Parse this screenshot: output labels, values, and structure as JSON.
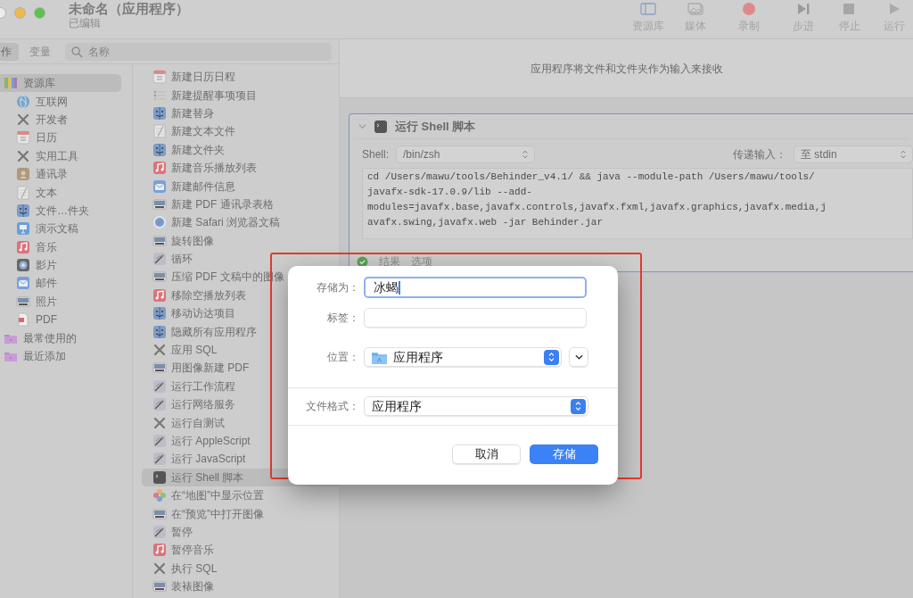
{
  "window": {
    "title": "未命名（应用程序）",
    "subtitle": "已编辑"
  },
  "toolbar": [
    {
      "label": "资源库"
    },
    {
      "label": "媒体"
    },
    {
      "label": "录制"
    },
    {
      "label": "步进"
    },
    {
      "label": "停止"
    },
    {
      "label": "运行"
    }
  ],
  "library_tabs": [
    {
      "label": "作",
      "selected": true
    },
    {
      "label": "变量",
      "selected": false
    }
  ],
  "search": {
    "placeholder": "名称"
  },
  "library": [
    {
      "label": "资源库",
      "selected": true,
      "children": [
        {
          "label": "互联网",
          "selected": false
        },
        {
          "label": "开发者",
          "selected": false
        },
        {
          "label": "日历",
          "selected": false
        },
        {
          "label": "实用工具",
          "selected": false
        },
        {
          "label": "通讯录",
          "selected": false
        },
        {
          "label": "文本",
          "selected": false
        },
        {
          "label": "文件…件夹",
          "selected": false
        },
        {
          "label": "演示文稿",
          "selected": false
        },
        {
          "label": "音乐",
          "selected": false
        },
        {
          "label": "影片",
          "selected": false
        },
        {
          "label": "邮件",
          "selected": false
        },
        {
          "label": "照片",
          "selected": false
        },
        {
          "label": "PDF",
          "selected": false
        }
      ]
    },
    {
      "label": "最常使用的",
      "selected": false
    },
    {
      "label": "最近添加",
      "selected": false
    }
  ],
  "actions": [
    {
      "label": "新建日历日程",
      "selected": false
    },
    {
      "label": "新建提醒事项项目",
      "selected": false
    },
    {
      "label": "新建替身",
      "selected": false
    },
    {
      "label": "新建文本文件",
      "selected": false
    },
    {
      "label": "新建文件夹",
      "selected": false
    },
    {
      "label": "新建音乐播放列表",
      "selected": false
    },
    {
      "label": "新建邮件信息",
      "selected": false
    },
    {
      "label": "新建 PDF 通讯录表格",
      "selected": false
    },
    {
      "label": "新建 Safari 浏览器文稿",
      "selected": false
    },
    {
      "label": "旋转图像",
      "selected": false
    },
    {
      "label": "循环",
      "selected": false
    },
    {
      "label": "压缩 PDF 文稿中的图像",
      "selected": false
    },
    {
      "label": "移除空播放列表",
      "selected": false
    },
    {
      "label": "移动访达项目",
      "selected": false
    },
    {
      "label": "隐藏所有应用程序",
      "selected": false
    },
    {
      "label": "应用 SQL",
      "selected": false
    },
    {
      "label": "用图像新建 PDF",
      "selected": false
    },
    {
      "label": "运行工作流程",
      "selected": false
    },
    {
      "label": "运行网络服务",
      "selected": false
    },
    {
      "label": "运行自测试",
      "selected": false
    },
    {
      "label": "运行 AppleScript",
      "selected": false
    },
    {
      "label": "运行 JavaScript",
      "selected": false
    },
    {
      "label": "运行 Shell 脚本",
      "selected": true
    },
    {
      "label": "在“地图”中显示位置",
      "selected": false
    },
    {
      "label": "在“预览”中打开图像",
      "selected": false
    },
    {
      "label": "暂停",
      "selected": false
    },
    {
      "label": "暂停音乐",
      "selected": false
    },
    {
      "label": "执行 SQL",
      "selected": false
    },
    {
      "label": "装裱图像",
      "selected": false
    }
  ],
  "workflow": {
    "input_hint": "应用程序将文件和文件夹作为输入来接收",
    "action": {
      "title": "运行 Shell 脚本",
      "shell_label": "Shell:",
      "shell": "/bin/zsh",
      "pass_input_label": "传递输入：",
      "pass_input": "至 stdin",
      "script_lines": [
        "cd /Users/mawu/tools/Behinder_v4.1/ && java --module-path /Users/mawu/tools/",
        "javafx-sdk-17.0.9/lib --add-",
        "modules=javafx.base,javafx.controls,javafx.fxml,javafx.graphics,javafx.media,j",
        "avafx.swing,javafx.web -jar Behinder.jar"
      ],
      "tabs": [
        "结果",
        "选项"
      ]
    }
  },
  "save_dialog": {
    "save_as_label": "存储为：",
    "save_as": "冰蝎",
    "tags_label": "标签：",
    "location_label": "位置：",
    "location": "应用程序",
    "format_label": "文件格式：",
    "format": "应用程序",
    "cancel": "取消",
    "save": "存储"
  }
}
